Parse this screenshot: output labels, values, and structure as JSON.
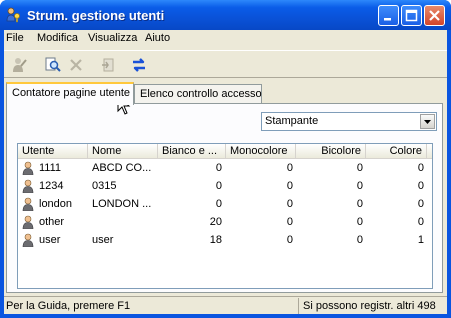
{
  "window": {
    "title": "Strum. gestione utenti",
    "title_icon": "users-key-icon"
  },
  "menubar": {
    "items": [
      "File",
      "Modifica",
      "Visualizza",
      "Aiuto"
    ]
  },
  "toolbar": {
    "buttons": [
      "user-edit-icon",
      "search-icon",
      "delete-icon",
      "export-icon",
      "refresh-icon"
    ]
  },
  "tabs": [
    {
      "label": "Contatore pagine utente",
      "active": true
    },
    {
      "label": "Elenco controllo accesso",
      "active": false
    }
  ],
  "device_select": {
    "value": "Stampante"
  },
  "table": {
    "columns": [
      "Utente",
      "Nome",
      "Bianco e ...",
      "Monocolore",
      "Bicolore",
      "Colore"
    ],
    "rows": [
      {
        "utente": "1111",
        "nome": "ABCD CO...",
        "bianco": "0",
        "mono": "0",
        "bicolore": "0",
        "colore": "0"
      },
      {
        "utente": "1234",
        "nome": "0315",
        "bianco": "0",
        "mono": "0",
        "bicolore": "0",
        "colore": "0"
      },
      {
        "utente": "london",
        "nome": "LONDON ...",
        "bianco": "0",
        "mono": "0",
        "bicolore": "0",
        "colore": "0"
      },
      {
        "utente": "other",
        "nome": "",
        "bianco": "20",
        "mono": "0",
        "bicolore": "0",
        "colore": "0"
      },
      {
        "utente": "user",
        "nome": "user",
        "bianco": "18",
        "mono": "0",
        "bicolore": "0",
        "colore": "1"
      }
    ]
  },
  "statusbar": {
    "help": "Per la Guida, premere F1",
    "info": "Si possono registr. altri 498"
  },
  "colors": {
    "titlebar": "#0a55e0",
    "face": "#ece9d8",
    "active_tab_accent": "#ffc83c"
  }
}
